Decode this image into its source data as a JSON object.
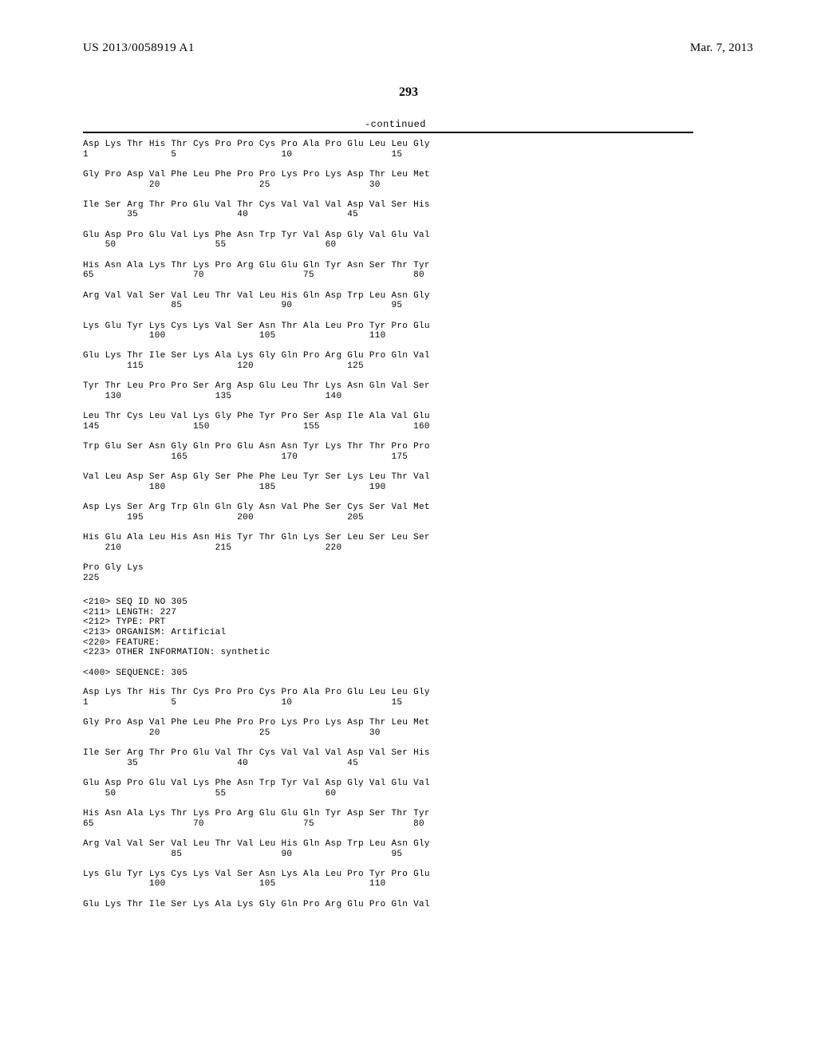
{
  "header": {
    "publication_number": "US 2013/0058919 A1",
    "publication_date": "Mar. 7, 2013"
  },
  "page_number": "293",
  "continued": "-continued",
  "sequence_block_1": "Asp Lys Thr His Thr Cys Pro Pro Cys Pro Ala Pro Glu Leu Leu Gly\n1               5                   10                  15\n\nGly Pro Asp Val Phe Leu Phe Pro Pro Lys Pro Lys Asp Thr Leu Met\n            20                  25                  30\n\nIle Ser Arg Thr Pro Glu Val Thr Cys Val Val Val Asp Val Ser His\n        35                  40                  45\n\nGlu Asp Pro Glu Val Lys Phe Asn Trp Tyr Val Asp Gly Val Glu Val\n    50                  55                  60\n\nHis Asn Ala Lys Thr Lys Pro Arg Glu Glu Gln Tyr Asn Ser Thr Tyr\n65                  70                  75                  80\n\nArg Val Val Ser Val Leu Thr Val Leu His Gln Asp Trp Leu Asn Gly\n                85                  90                  95\n\nLys Glu Tyr Lys Cys Lys Val Ser Asn Thr Ala Leu Pro Tyr Pro Glu\n            100                 105                 110\n\nGlu Lys Thr Ile Ser Lys Ala Lys Gly Gln Pro Arg Glu Pro Gln Val\n        115                 120                 125\n\nTyr Thr Leu Pro Pro Ser Arg Asp Glu Leu Thr Lys Asn Gln Val Ser\n    130                 135                 140\n\nLeu Thr Cys Leu Val Lys Gly Phe Tyr Pro Ser Asp Ile Ala Val Glu\n145                 150                 155                 160\n\nTrp Glu Ser Asn Gly Gln Pro Glu Asn Asn Tyr Lys Thr Thr Pro Pro\n                165                 170                 175\n\nVal Leu Asp Ser Asp Gly Ser Phe Phe Leu Tyr Ser Lys Leu Thr Val\n            180                 185                 190\n\nAsp Lys Ser Arg Trp Gln Gln Gly Asn Val Phe Ser Cys Ser Val Met\n        195                 200                 205\n\nHis Glu Ala Leu His Asn His Tyr Thr Gln Lys Ser Leu Ser Leu Ser\n    210                 215                 220\n\nPro Gly Lys\n225",
  "seq_header": "<210> SEQ ID NO 305\n<211> LENGTH: 227\n<212> TYPE: PRT\n<213> ORGANISM: Artificial\n<220> FEATURE:\n<223> OTHER INFORMATION: synthetic\n\n<400> SEQUENCE: 305",
  "sequence_block_2": "Asp Lys Thr His Thr Cys Pro Pro Cys Pro Ala Pro Glu Leu Leu Gly\n1               5                   10                  15\n\nGly Pro Asp Val Phe Leu Phe Pro Pro Lys Pro Lys Asp Thr Leu Met\n            20                  25                  30\n\nIle Ser Arg Thr Pro Glu Val Thr Cys Val Val Val Asp Val Ser His\n        35                  40                  45\n\nGlu Asp Pro Glu Val Lys Phe Asn Trp Tyr Val Asp Gly Val Glu Val\n    50                  55                  60\n\nHis Asn Ala Lys Thr Lys Pro Arg Glu Glu Gln Tyr Asp Ser Thr Tyr\n65                  70                  75                  80\n\nArg Val Val Ser Val Leu Thr Val Leu His Gln Asp Trp Leu Asn Gly\n                85                  90                  95\n\nLys Glu Tyr Lys Cys Lys Val Ser Asn Lys Ala Leu Pro Tyr Pro Glu\n            100                 105                 110\n\nGlu Lys Thr Ile Ser Lys Ala Lys Gly Gln Pro Arg Glu Pro Gln Val"
}
